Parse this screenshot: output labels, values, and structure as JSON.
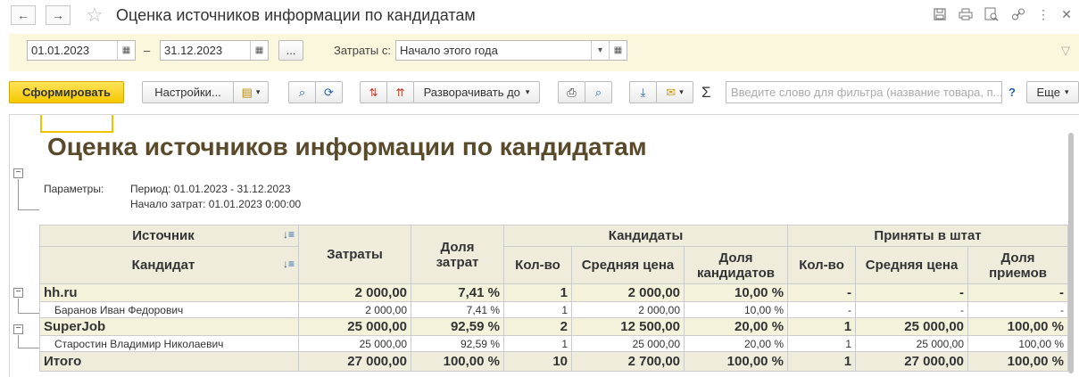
{
  "window": {
    "title": "Оценка источников информации по кандидатам",
    "back_icon": "←",
    "forward_icon": "→"
  },
  "params": {
    "date_from": "01.01.2023",
    "dash": "–",
    "date_to": "31.12.2023",
    "ellipsis_label": "...",
    "costs_label": "Затраты с:",
    "costs_value": "Начало этого года"
  },
  "toolbar": {
    "generate_label": "Сформировать",
    "settings_label": "Настройки...",
    "expand_label": "Разворачивать до",
    "sigma": "Σ",
    "search_placeholder": "Введите слово для фильтра (название товара, п...",
    "help": "?",
    "more_label": "Еще"
  },
  "report": {
    "title": "Оценка источников информации по кандидатам",
    "params_label": "Параметры:",
    "period": "Период: 01.01.2023 - 31.12.2023",
    "costs_start": "Начало затрат: 01.01.2023 0:00:00",
    "headers": {
      "source": "Источник",
      "candidate": "Кандидат",
      "costs": "Затраты",
      "cost_share_1": "Доля",
      "cost_share_2": "затрат",
      "candidates": "Кандидаты",
      "hired": "Приняты в штат",
      "count": "Кол-во",
      "avg_price": "Средняя цена",
      "cand_share_1": "Доля",
      "cand_share_2": "кандидатов",
      "hired_count": "Кол-во",
      "hired_avg_price": "Средняя цена",
      "hire_share_1": "Доля",
      "hire_share_2": "приемов"
    },
    "rows": [
      {
        "name": "hh.ru",
        "costs": "2 000,00",
        "cost_share": "7,41 %",
        "count": "1",
        "avg": "2 000,00",
        "cand_share": "10,00 %",
        "h_count": "-",
        "h_avg": "-",
        "h_share": "-"
      },
      {
        "name": "Баранов Иван Федорович",
        "costs": "2 000,00",
        "cost_share": "7,41 %",
        "count": "1",
        "avg": "2 000,00",
        "cand_share": "10,00 %",
        "h_count": "-",
        "h_avg": "-",
        "h_share": "-"
      },
      {
        "name": "SuperJob",
        "costs": "25 000,00",
        "cost_share": "92,59 %",
        "count": "2",
        "avg": "12 500,00",
        "cand_share": "20,00 %",
        "h_count": "1",
        "h_avg": "25 000,00",
        "h_share": "100,00 %"
      },
      {
        "name": "Старостин Владимир Николаевич",
        "costs": "25 000,00",
        "cost_share": "92,59 %",
        "count": "1",
        "avg": "25 000,00",
        "cand_share": "20,00 %",
        "h_count": "1",
        "h_avg": "25 000,00",
        "h_share": "100,00 %"
      }
    ],
    "total": {
      "name": "Итого",
      "costs": "27 000,00",
      "cost_share": "100,00 %",
      "count": "10",
      "avg": "2 700,00",
      "cand_share": "100,00 %",
      "h_count": "1",
      "h_avg": "27 000,00",
      "h_share": "100,00 %"
    }
  }
}
